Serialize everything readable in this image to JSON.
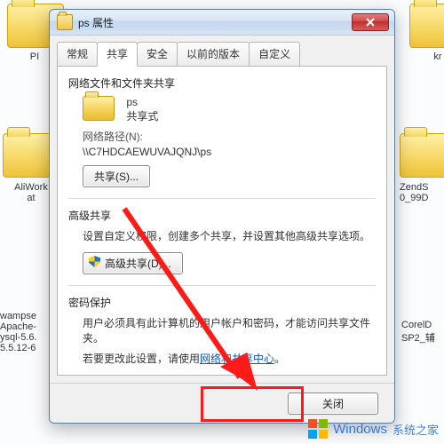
{
  "bg_items": {
    "aliwork": "AliWork\nat",
    "zends": "ZendS\n0_99D",
    "wamp": "wampse\nApache-\nysql-5.6.\n5.5.12-6",
    "corel": "CorelD\nSP2_辅",
    "kr": "kr",
    "pi": "PI"
  },
  "dialog": {
    "title": "ps 属性",
    "tabs": {
      "general": "常规",
      "share": "共享",
      "security": "安全",
      "previous": "以前的版本",
      "custom": "自定义"
    },
    "section1": {
      "heading": "网络文件和文件夹共享",
      "folder_name": "ps",
      "share_state": "共享式",
      "netpath_label": "网络路径(N):",
      "netpath_value": "\\\\C7HDCAEWUVAJQNJ\\ps",
      "share_btn": "共享(S)..."
    },
    "section2": {
      "heading": "高级共享",
      "desc": "设置自定义权限，创建多个共享，并设置其他高级共享选项。",
      "adv_btn": "高级共享(D)..."
    },
    "section3": {
      "heading": "密码保护",
      "line1": "用户必须具有此计算机的用户帐户和密码，才能访问共享文件夹。",
      "line2a": "若要更改此设置，请使用",
      "link": "网络和共享中心",
      "line2b": "。"
    },
    "buttons": {
      "close": "关闭"
    }
  },
  "watermark": {
    "brand": "Windows",
    "sub": "系统之家"
  }
}
